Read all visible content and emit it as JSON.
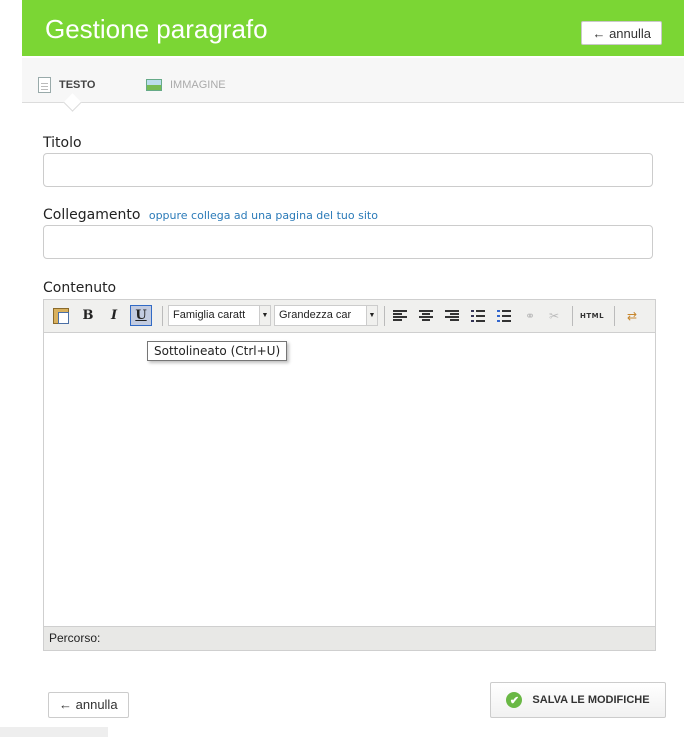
{
  "header": {
    "title": "Gestione paragrafo",
    "cancel_label": "annulla",
    "cancel_icon": "arrow-left-icon"
  },
  "tabs": [
    {
      "label": "TESTO",
      "icon": "document-icon",
      "active": true
    },
    {
      "label": "IMMAGINE",
      "icon": "image-icon",
      "active": false
    }
  ],
  "form": {
    "title_label": "Titolo",
    "title_value": "",
    "link_label": "Collegamento",
    "link_alt_text": "oppure collega ad una pagina del tuo sito",
    "link_value": "",
    "content_label": "Contenuto"
  },
  "editor": {
    "toolbar": {
      "bold": "B",
      "italic": "I",
      "underline": "U",
      "font_family": "Famiglia caratt",
      "font_size": "Grandezza car",
      "html": "HTML"
    },
    "tooltip": "Sottolineato (Ctrl+U)",
    "status_path": "Percorso:"
  },
  "footer": {
    "cancel_label": "annulla",
    "save_label": "SALVA LE MODIFICHE"
  },
  "colors": {
    "header_green": "#7bd634",
    "link_blue": "#2a7ab8",
    "check_green": "#6ab845"
  }
}
